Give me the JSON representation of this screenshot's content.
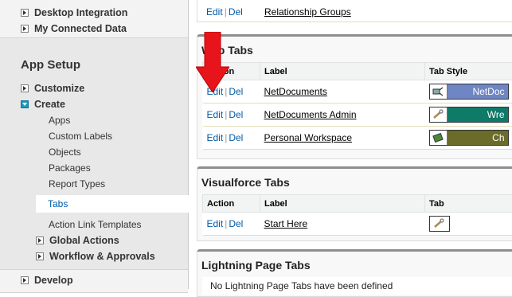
{
  "sidebar": {
    "top_items": [
      {
        "label": "Desktop Integration"
      },
      {
        "label": "My Connected Data"
      }
    ],
    "section_title": "App Setup",
    "customize_label": "Customize",
    "create_label": "Create",
    "create_children": [
      "Apps",
      "Custom Labels",
      "Objects",
      "Packages",
      "Report Types",
      "Tabs",
      "Action Link Templates"
    ],
    "global_actions_label": "Global Actions",
    "workflow_label": "Workflow & Approvals",
    "develop_label": "Develop"
  },
  "main": {
    "top_row": {
      "edit": "Edit",
      "sep": "|",
      "del": "Del",
      "label": "Relationship Groups"
    },
    "web_tabs": {
      "title": "Web Tabs",
      "columns": [
        "Action",
        "Label",
        "Tab Style"
      ],
      "rows": [
        {
          "edit": "Edit",
          "del": "Del",
          "label": "NetDocuments",
          "style": "NetDoc",
          "color": "#6f86c4"
        },
        {
          "edit": "Edit",
          "del": "Del",
          "label": "NetDocuments Admin",
          "style": "Wre",
          "color": "#0e7a68"
        },
        {
          "edit": "Edit",
          "del": "Del",
          "label": "Personal Workspace",
          "style": "Ch",
          "color": "#6b6b2a"
        }
      ]
    },
    "vf_tabs": {
      "title": "Visualforce Tabs",
      "columns": [
        "Action",
        "Label",
        "Tab"
      ],
      "rows": [
        {
          "edit": "Edit",
          "del": "Del",
          "label": "Start Here"
        }
      ]
    },
    "lightning_tabs": {
      "title": "Lightning Page Tabs",
      "empty_text": "No Lightning Page Tabs have been defined"
    }
  },
  "colors": {
    "arrow": "#e8141c",
    "link": "#015ba7"
  }
}
